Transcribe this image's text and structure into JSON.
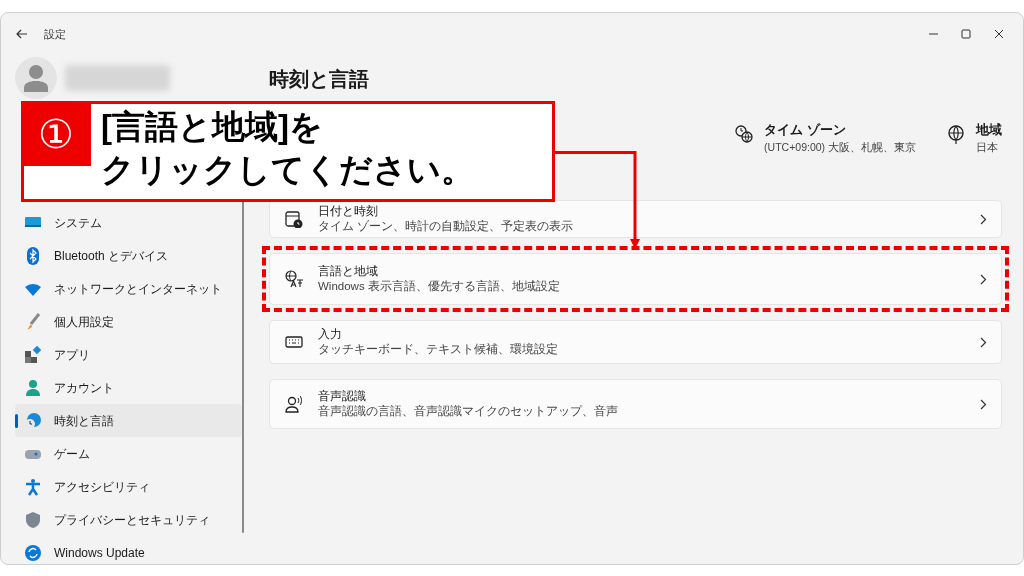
{
  "window": {
    "title": "設定"
  },
  "sidebar": {
    "items": [
      {
        "label": "システム",
        "selected": false
      },
      {
        "label": "Bluetooth とデバイス",
        "selected": false
      },
      {
        "label": "ネットワークとインターネット",
        "selected": false
      },
      {
        "label": "個人用設定",
        "selected": false
      },
      {
        "label": "アプリ",
        "selected": false
      },
      {
        "label": "アカウント",
        "selected": false
      },
      {
        "label": "時刻と言語",
        "selected": true
      },
      {
        "label": "ゲーム",
        "selected": false
      },
      {
        "label": "アクセシビリティ",
        "selected": false
      },
      {
        "label": "プライバシーとセキュリティ",
        "selected": false
      },
      {
        "label": "Windows Update",
        "selected": false
      }
    ]
  },
  "page": {
    "title": "時刻と言語",
    "info": [
      {
        "label": "タイム ゾーン",
        "value": "(UTC+09:00) 大阪、札幌、東京"
      },
      {
        "label": "地域",
        "value": "日本"
      }
    ],
    "cards": [
      {
        "title": "日付と時刻",
        "subtitle": "タイム ゾーン、時計の自動設定、予定表の表示",
        "highlighted": false
      },
      {
        "title": "言語と地域",
        "subtitle": "Windows 表示言語、優先する言語、地域設定",
        "highlighted": true
      },
      {
        "title": "入力",
        "subtitle": "タッチキーボード、テキスト候補、環境設定",
        "highlighted": false
      },
      {
        "title": "音声認識",
        "subtitle": "音声認識の言語、音声認識マイクのセットアップ、音声",
        "highlighted": false
      }
    ]
  },
  "annotation": {
    "number": "①",
    "lines": [
      "[言語と地域]を",
      "クリックしてください。"
    ]
  }
}
